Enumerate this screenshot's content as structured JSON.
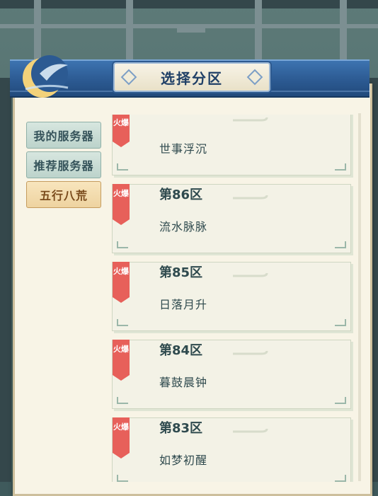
{
  "header": {
    "title": "选择分区"
  },
  "tabs": [
    {
      "label": "我的服务器",
      "active": false
    },
    {
      "label": "推荐服务器",
      "active": false
    },
    {
      "label": "五行八荒",
      "active": true
    }
  ],
  "hot_label": "火爆",
  "servers": [
    {
      "number": "",
      "name": "世事浮沉"
    },
    {
      "number": "第86区",
      "name": "流水脉脉"
    },
    {
      "number": "第85区",
      "name": "日落月升"
    },
    {
      "number": "第84区",
      "name": "暮鼓晨钟"
    },
    {
      "number": "第83区",
      "name": "如梦初醒"
    }
  ],
  "colors": {
    "header_blue": "#2c5a92",
    "ribbon_red": "#e7605a",
    "active_tab": "#eed3a0",
    "inactive_tab": "#bcd3cb"
  }
}
